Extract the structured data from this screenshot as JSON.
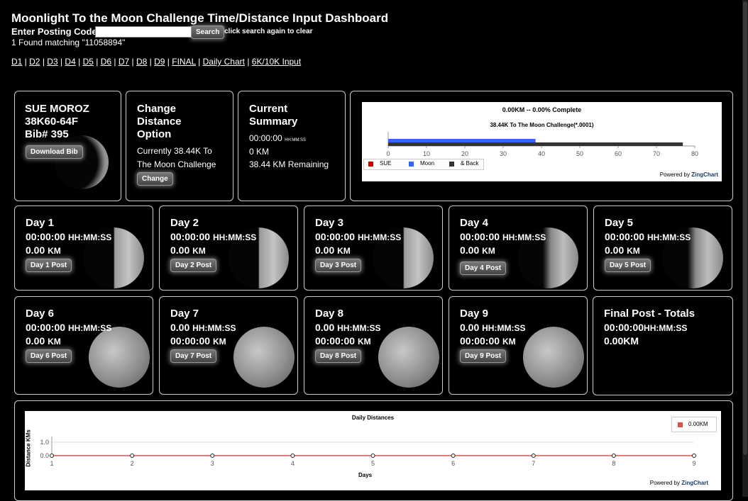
{
  "title": "Moonlight To the Moon Challenge Time/Distance Input Dashboard",
  "search": {
    "label": "Enter Posting Code:",
    "value": "",
    "button": "Search",
    "hint": "click search again to clear",
    "found": "1 Found matching \"11058894\""
  },
  "nav": [
    "D1",
    "D2",
    "D3",
    "D4",
    "D5",
    "D6",
    "D7",
    "D8",
    "D9",
    "FINAL",
    "Daily Chart",
    "6K/10K Input"
  ],
  "runner": {
    "name": "SUE MOROZ",
    "category": "38K60-64F",
    "bib": "Bib# 395",
    "download": "Download Bib"
  },
  "distance": {
    "heading1": "Change",
    "heading2": "Distance",
    "heading3": "Option",
    "line1": "Currently 38.44K To",
    "line2": "The Moon Challenge",
    "button": "Change"
  },
  "summary": {
    "heading1": "Current",
    "heading2": "Summary",
    "time": "00:00:00",
    "time_unit": "HH:MM:SS",
    "km": "0 KM",
    "remaining": "38.44 KM Remaining"
  },
  "progress_chart": {
    "title": "0.00KM -- 0.00% Complete",
    "subtitle": "38.44K To The Moon Challenge(*.0001)",
    "ticks": [
      "0",
      "10",
      "20",
      "30",
      "40",
      "50",
      "60",
      "70",
      "80"
    ],
    "legend": [
      "SUE",
      "Moon",
      "& Back"
    ],
    "legend_colors": [
      "#cc0000",
      "#3366ff",
      "#333333"
    ],
    "powered": "Powered by",
    "brand": "ZingChart"
  },
  "chart_data": [
    {
      "type": "bar",
      "title": "0.00KM -- 0.00% Complete",
      "subtitle": "38.44K To The Moon Challenge(*.0001)",
      "series": [
        {
          "name": "SUE",
          "values": [
            0
          ]
        },
        {
          "name": "Moon",
          "values": [
            38.44
          ]
        },
        {
          "name": "& Back",
          "values": [
            76.88
          ]
        }
      ],
      "xlim": [
        0,
        80
      ]
    },
    {
      "type": "line",
      "title": "Daily Distances",
      "xlabel": "Days",
      "ylabel": "Distance KMs",
      "x": [
        1,
        2,
        3,
        4,
        5,
        6,
        7,
        8,
        9
      ],
      "series": [
        {
          "name": "0.00KM",
          "values": [
            0,
            0,
            0,
            0,
            0,
            0,
            0,
            0,
            0
          ]
        }
      ],
      "ylim": [
        0,
        1.0
      ]
    }
  ],
  "days": [
    {
      "title": "Day 1",
      "l1": "00:00:00",
      "u1": "HH:MM:SS",
      "l2": "0.00",
      "u2": "KM",
      "button": "Day 1 Post"
    },
    {
      "title": "Day 2",
      "l1": "00:00:00",
      "u1": "HH:MM:SS",
      "l2": "0.00",
      "u2": "KM",
      "button": "Day 2 Post"
    },
    {
      "title": "Day 3",
      "l1": "00:00:00",
      "u1": "HH:MM:SS",
      "l2": "0.00",
      "u2": "KM",
      "button": "Day 3 Post"
    },
    {
      "title": "Day 4",
      "l1": "00:00:00",
      "u1": "HH:MM:SS",
      "l2": "0.00",
      "u2": "KM",
      "button": "Day 4 Post"
    },
    {
      "title": "Day 5",
      "l1": "00:00:00",
      "u1": "HH:MM:SS",
      "l2": "0.00",
      "u2": "KM",
      "button": "Day 5 Post"
    },
    {
      "title": "Day 6",
      "l1": "00:00:00",
      "u1": "HH:MM:SS",
      "l2": "0.00",
      "u2": "KM",
      "button": "Day 6 Post"
    },
    {
      "title": "Day 7",
      "l1": "0.00",
      "u1": "HH:MM:SS",
      "l2": "00:00:00",
      "u2": "KM",
      "button": "Day 7 Post"
    },
    {
      "title": "Day 8",
      "l1": "0.00",
      "u1": "HH:MM:SS",
      "l2": "00:00:00",
      "u2": "KM",
      "button": "Day 8 Post"
    },
    {
      "title": "Day 9",
      "l1": "0.00",
      "u1": "HH:MM:SS",
      "l2": "00:00:00",
      "u2": "KM",
      "button": "Day 9 Post"
    }
  ],
  "final": {
    "title": "Final Post - Totals",
    "time": "00:00:00",
    "unit": "HH:MM:SS",
    "km": "0.00KM"
  },
  "daily_chart": {
    "title": "Daily Distances",
    "ylabel": "Distance KMs",
    "xlabel": "Days",
    "yticks": [
      "1.0",
      "0.0"
    ],
    "xticks": [
      "1",
      "2",
      "3",
      "4",
      "5",
      "6",
      "7",
      "8",
      "9"
    ],
    "legend": "0.00KM",
    "powered": "Powered by",
    "brand": "ZingChart"
  }
}
